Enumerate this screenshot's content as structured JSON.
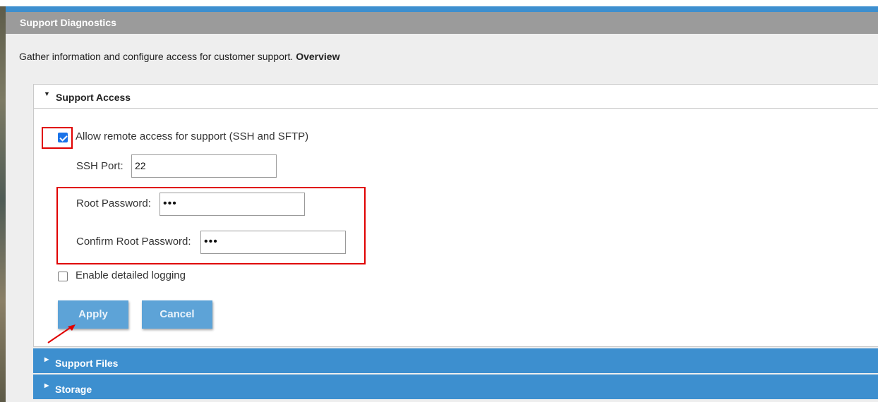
{
  "page": {
    "title": "Support Diagnostics",
    "intro_text": "Gather information and configure access for customer support.",
    "intro_link": "Overview"
  },
  "support_access": {
    "title": "Support Access",
    "remote_access_label": "Allow remote access for support (SSH and SFTP)",
    "remote_access_checked": true,
    "ssh_port_label": "SSH Port:",
    "ssh_port_value": "22",
    "root_password_label": "Root Password:",
    "root_password_value": "•••",
    "confirm_password_label": "Confirm Root Password:",
    "confirm_password_value": "•••",
    "detailed_logging_label": "Enable detailed logging",
    "detailed_logging_checked": false,
    "apply_label": "Apply",
    "cancel_label": "Cancel"
  },
  "sections": [
    {
      "label": "Support Files"
    },
    {
      "label": "Storage"
    }
  ],
  "colors": {
    "accent": "#3d8fcf",
    "button": "#5da3d7",
    "title_bar": "#9b9b9b",
    "highlight": "#e00000"
  }
}
